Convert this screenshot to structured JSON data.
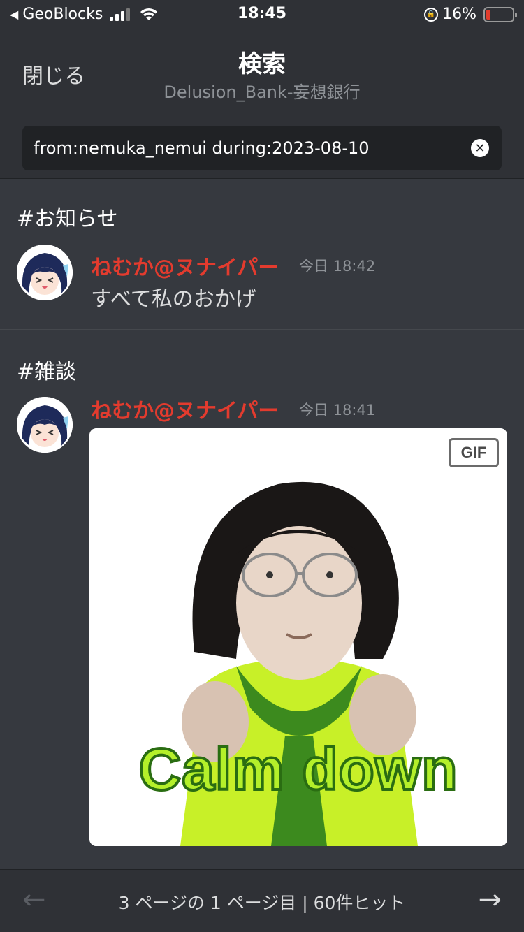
{
  "status_bar": {
    "carrier": "GeoBlocks",
    "time": "18:45",
    "battery_percent": "16%",
    "battery_level": 0.16
  },
  "header": {
    "close_label": "閉じる",
    "title": "検索",
    "subtitle": "Delusion_Bank-妄想銀行"
  },
  "search": {
    "value": "from:nemuka_nemui during:2023-08-10"
  },
  "results": [
    {
      "channel": "#お知らせ",
      "author": "ねむか@ヌナイパー",
      "timestamp": "今日 18:42",
      "text": "すべて私のおかげ"
    },
    {
      "channel": "#雑談",
      "author": "ねむか@ヌナイパー",
      "timestamp": "今日 18:41",
      "attachment": {
        "badge": "GIF",
        "caption": "Calm down"
      }
    }
  ],
  "pagination": {
    "info": "3 ページの 1 ページ目 | 60件ヒット"
  },
  "colors": {
    "background": "#36393f",
    "header": "#2f3136",
    "author": "#e33b2e",
    "gif_caption": "#b4f02a"
  }
}
